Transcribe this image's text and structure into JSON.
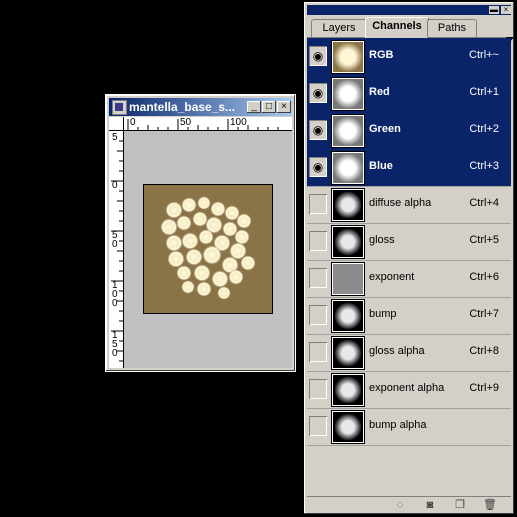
{
  "document": {
    "title": "mantella_base_s...",
    "ruler_h": [
      "0",
      "50",
      "100"
    ],
    "ruler_v": [
      "5",
      "0",
      "5\n0",
      "1\n0\n0",
      "1\n5\n0"
    ]
  },
  "panel": {
    "tabs": [
      "Layers",
      "Channels",
      "Paths"
    ],
    "active_tab": "Channels",
    "channels": [
      {
        "name": "RGB",
        "shortcut": "Ctrl+~",
        "visible": true,
        "selected": true,
        "thumb": "rgb"
      },
      {
        "name": "Red",
        "shortcut": "Ctrl+1",
        "visible": true,
        "selected": true,
        "thumb": "gray"
      },
      {
        "name": "Green",
        "shortcut": "Ctrl+2",
        "visible": true,
        "selected": true,
        "thumb": "gray"
      },
      {
        "name": "Blue",
        "shortcut": "Ctrl+3",
        "visible": true,
        "selected": true,
        "thumb": "gray"
      },
      {
        "name": "diffuse alpha",
        "shortcut": "Ctrl+4",
        "visible": false,
        "selected": false,
        "thumb": "dark"
      },
      {
        "name": "gloss",
        "shortcut": "Ctrl+5",
        "visible": false,
        "selected": false,
        "thumb": "dark"
      },
      {
        "name": "exponent",
        "shortcut": "Ctrl+6",
        "visible": false,
        "selected": false,
        "thumb": "flat"
      },
      {
        "name": "bump",
        "shortcut": "Ctrl+7",
        "visible": false,
        "selected": false,
        "thumb": "dark"
      },
      {
        "name": "gloss alpha",
        "shortcut": "Ctrl+8",
        "visible": false,
        "selected": false,
        "thumb": "dark"
      },
      {
        "name": "exponent alpha",
        "shortcut": "Ctrl+9",
        "visible": false,
        "selected": false,
        "thumb": "dark"
      },
      {
        "name": "bump alpha",
        "shortcut": "",
        "visible": false,
        "selected": false,
        "thumb": "dark"
      }
    ],
    "bottom_icons": [
      "load-selection-icon",
      "save-selection-icon",
      "new-channel-icon",
      "trash-icon"
    ]
  },
  "colors": {
    "selection": "#0a246a",
    "image_bg": "#8a7347",
    "panel_bg": "#d4d0c8"
  }
}
